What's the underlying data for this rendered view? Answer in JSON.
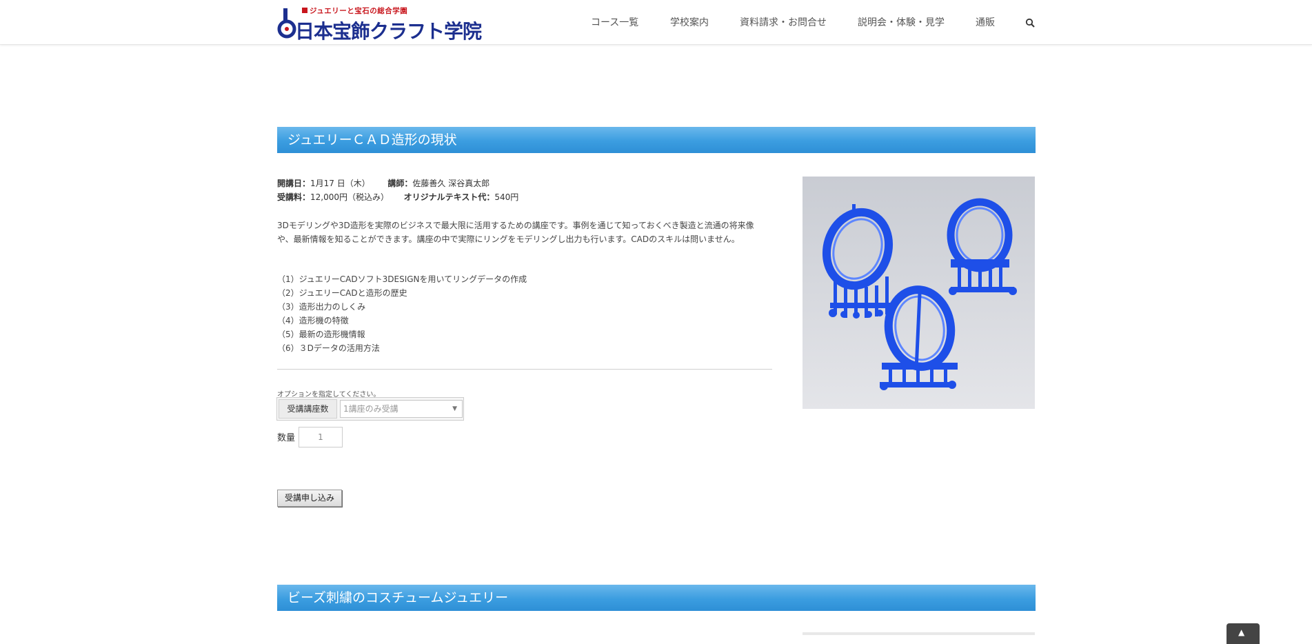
{
  "header": {
    "logo_tagline": "ジュエリーと宝石の総合学園",
    "logo_name": "日本宝飾クラフト学院",
    "nav": [
      {
        "label": "コース一覧"
      },
      {
        "label": "学校案内"
      },
      {
        "label": "資料請求・お問合せ"
      },
      {
        "label": "説明会・体験・見学"
      },
      {
        "label": "通販"
      }
    ]
  },
  "course": {
    "heading": "ジュエリーＣＡＤ造形の現状",
    "date_label": "開講日：",
    "date_value": "1月17 日（木）",
    "lecturer_label": "講師：",
    "lecturer_value": "佐藤善久 深谷真太郎",
    "fee_label": "受講料：",
    "fee_value": "12,000円（税込み）",
    "text_fee_label": "オリジナルテキスト代：",
    "text_fee_value": "540円",
    "description": "3Dモデリングや3D造形を実際のビジネスで最大限に活用するための講座です。事例を通じて知っておくべき製造と流通の将来像や、最新情報を知ることができます。講座の中で実際にリングをモデリングし出力も行います。CADのスキルは問いません。",
    "outline": [
      "（1）ジュエリーCADソフト3DESIGNを用いてリングデータの作成",
      "（2）ジュエリーCADと造形の歴史",
      "（3）造形出力のしくみ",
      "（4）造形機の特徴",
      "（5）最新の造形機情報",
      "（6）３Dデータの活用方法"
    ],
    "option_note": "オプションを指定してください。",
    "option_label": "受講講座数",
    "option_selected": "1講座のみ受講",
    "qty_label": "数量",
    "qty_value": "1",
    "apply_label": "受講申し込み"
  },
  "next_course": {
    "heading": "ビーズ刺繍のコスチュームジュエリー"
  },
  "colors": {
    "heading_blue": "#3b9de0",
    "logo_navy": "#1c2f8f",
    "logo_red": "#c8161d",
    "resin_blue": "#1e4fe8"
  }
}
